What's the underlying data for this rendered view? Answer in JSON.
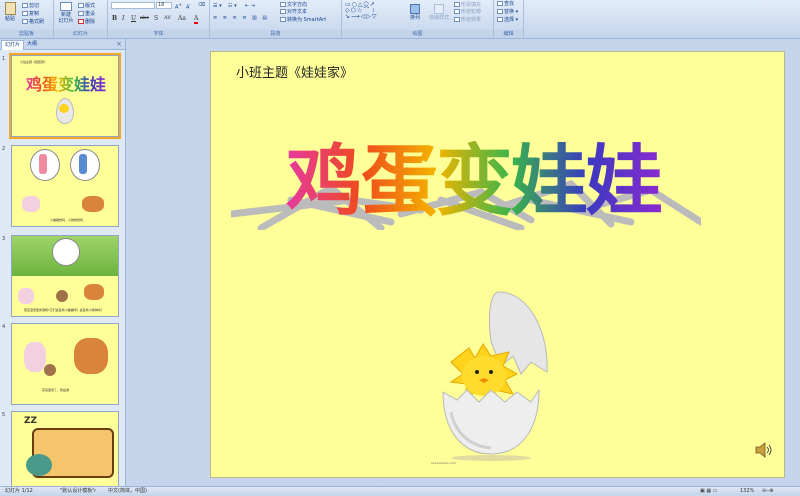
{
  "ribbon": {
    "clipboard": {
      "paste": "粘贴",
      "cut": "剪切",
      "copy": "复制",
      "painter": "格式刷",
      "label": "剪贴板"
    },
    "slides": {
      "new": "新建",
      "new2": "幻灯片",
      "layout": "版式",
      "reset": "重设",
      "delete": "删除",
      "label": "幻灯片"
    },
    "font": {
      "size": "18",
      "label": "字体",
      "bold": "B",
      "italic": "I",
      "underline": "U",
      "strike": "abc",
      "shadow": "S",
      "spacing": "AV",
      "case": "Aa",
      "color": "A"
    },
    "paragraph": {
      "direction": "文字方向",
      "align": "对齐文本",
      "smartart": "转换为 SmartArt",
      "label": "段落"
    },
    "drawing": {
      "arrange": "排列",
      "quickstyles": "快速样式",
      "fill": "形状填充",
      "outline": "形状轮廓",
      "effects": "形状效果",
      "label": "绘图"
    },
    "editing": {
      "find": "查找",
      "replace": "替换",
      "select": "选择",
      "label": "编辑"
    }
  },
  "sidebar": {
    "tabs": {
      "slides": "幻灯片",
      "outline": "大纲",
      "close": "×"
    },
    "thumbnails": [
      {
        "num": "1",
        "title": "鸡蛋变娃娃",
        "caption": "小班主题《娃娃家》"
      },
      {
        "num": "2",
        "caption": "小猫猫想吗，小狗狗想吗"
      },
      {
        "num": "3",
        "caption": "蛋宝宝想变成谁呢?它们会变成小猫猫吗？会变成小狗狗吗？"
      },
      {
        "num": "4",
        "caption": "原来变成了，我是谁"
      },
      {
        "num": "5",
        "caption": ""
      }
    ]
  },
  "slide": {
    "subtitle": "小班主题《娃娃家》",
    "title_chars": [
      "鸡",
      "蛋",
      "变",
      "娃",
      "娃"
    ],
    "title_colors": [
      "#e63aa0",
      "#ef4a1c",
      "#f4b400",
      "#39b54a",
      "#3a3ac0",
      "#8a2bd0"
    ],
    "credit": "xxxxxxxxxx.com"
  },
  "statusbar": {
    "slide_index": "幻灯片 1/12",
    "theme": "\"默认设计模板\"",
    "language": "中文(简体，中国)",
    "zoom": "132%"
  }
}
